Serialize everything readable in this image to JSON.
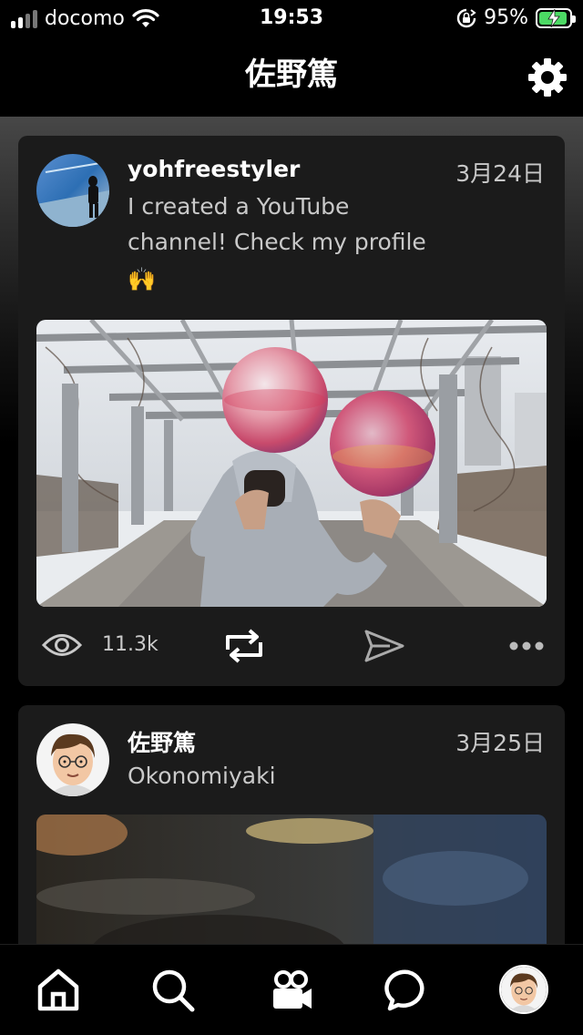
{
  "status_bar": {
    "carrier": "docomo",
    "time": "19:53",
    "battery_percent": "95%",
    "battery_level": 0.95,
    "signal_bars": 4,
    "signal_active": 2
  },
  "header": {
    "title": "佐野篤",
    "settings_icon": "gear-icon"
  },
  "posts": [
    {
      "username": "yohfreestyler",
      "date": "3月24日",
      "text": "I created a YouTube channel! Check my profile",
      "emoji": "🙌",
      "media": "photo-freestyle-football-two-balls",
      "views": "11.3k",
      "actions": [
        "eye-icon",
        "repost-icon",
        "share-icon",
        "more-icon"
      ]
    },
    {
      "username": "佐野篤",
      "date": "3月25日",
      "text": "Okonomiyaki",
      "media": "video-thumbnail-blurred"
    }
  ],
  "tabbar": {
    "tabs": [
      "home-icon",
      "search-icon",
      "video-icon",
      "messages-icon",
      "profile-avatar"
    ]
  },
  "colors": {
    "background": "#000000",
    "card": "#1b1b1b",
    "text_secondary": "#c9c9c9",
    "battery_green": "#4cd964"
  }
}
